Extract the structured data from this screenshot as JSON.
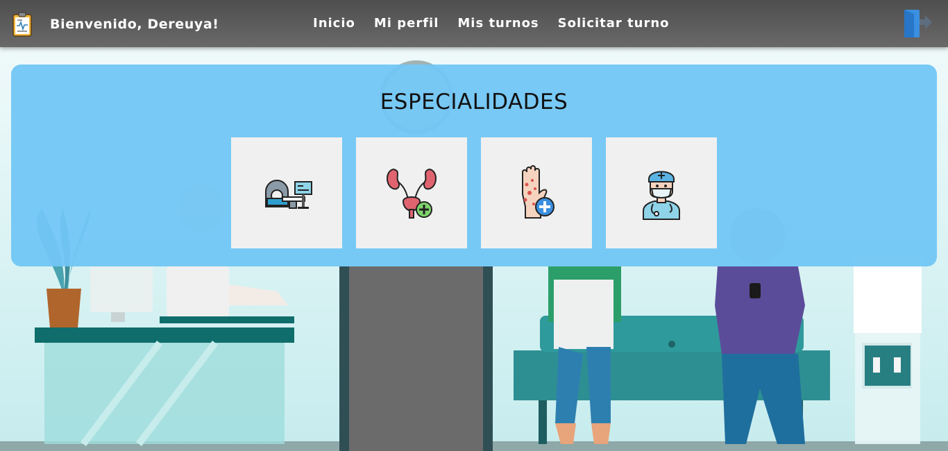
{
  "header": {
    "welcome": "Bienvenido, Dereuya!",
    "nav": [
      "Inicio",
      "Mi perfil",
      "Mis turnos",
      "Solicitar turno"
    ],
    "brand_icon": "clipboard-health-icon",
    "logout_icon": "logout-door-icon"
  },
  "specialties": {
    "title": "ESPECIALIDADES",
    "items": [
      {
        "icon": "mri-scanner-icon"
      },
      {
        "icon": "kidney-urology-icon"
      },
      {
        "icon": "dermatology-hand-icon"
      },
      {
        "icon": "doctor-icon"
      }
    ]
  },
  "colors": {
    "navbar": "#5a5959",
    "panel": "#72c6f4",
    "card": "#f0f0f0",
    "accent_teal": "#0f6e6c"
  }
}
